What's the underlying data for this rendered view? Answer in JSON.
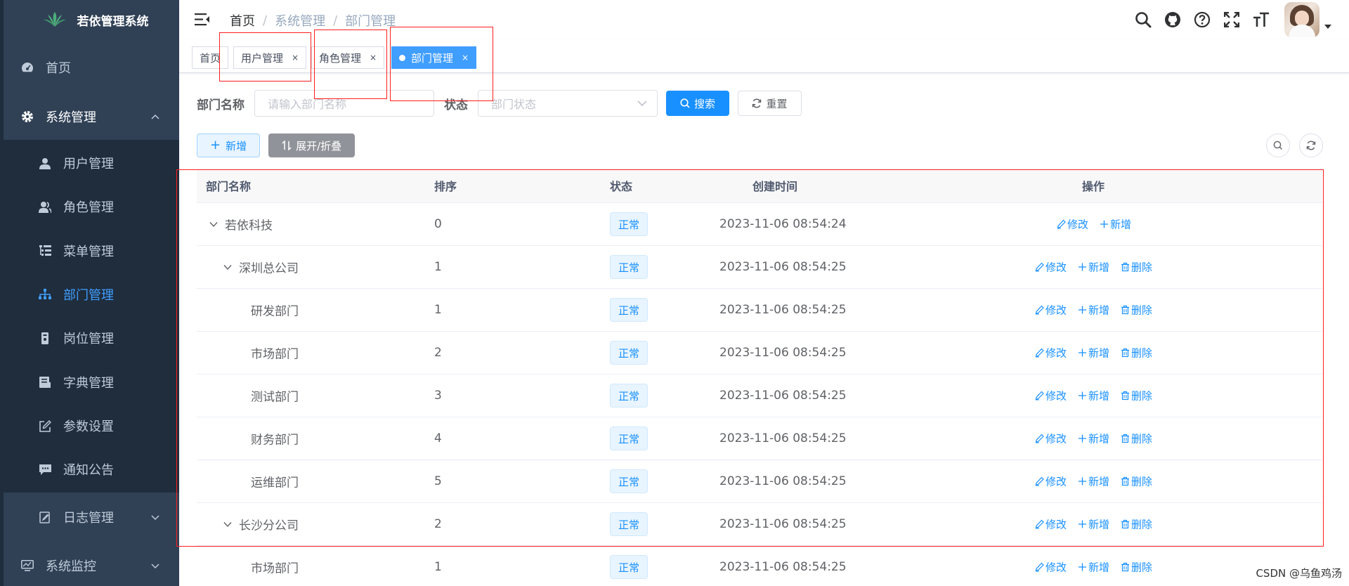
{
  "app": {
    "title": "若依管理系统"
  },
  "sidebar": {
    "items": [
      {
        "label": "首页",
        "icon": "dashboard-icon"
      },
      {
        "label": "系统管理",
        "icon": "gear-icon",
        "expanded": true,
        "children": [
          {
            "label": "用户管理",
            "icon": "user-icon"
          },
          {
            "label": "角色管理",
            "icon": "peoples-icon"
          },
          {
            "label": "菜单管理",
            "icon": "tree-table-icon"
          },
          {
            "label": "部门管理",
            "icon": "tree-icon",
            "active": true
          },
          {
            "label": "岗位管理",
            "icon": "post-icon"
          },
          {
            "label": "字典管理",
            "icon": "dict-icon"
          },
          {
            "label": "参数设置",
            "icon": "edit-icon"
          },
          {
            "label": "通知公告",
            "icon": "message-icon"
          },
          {
            "label": "日志管理",
            "icon": "log-icon"
          }
        ]
      },
      {
        "label": "系统监控",
        "icon": "monitor-icon"
      }
    ]
  },
  "breadcrumb": {
    "home": "首页",
    "section": "系统管理",
    "page": "部门管理"
  },
  "navbar": {
    "icons": [
      "search-icon",
      "github-icon",
      "question-icon",
      "fullscreen-icon",
      "font-size-icon"
    ]
  },
  "tags": [
    {
      "label": "首页",
      "closable": false
    },
    {
      "label": "用户管理",
      "closable": true
    },
    {
      "label": "角色管理",
      "closable": true
    },
    {
      "label": "部门管理",
      "closable": true,
      "active": true
    }
  ],
  "tag_close": "×",
  "search": {
    "dept_label": "部门名称",
    "dept_placeholder": "请输入部门名称",
    "status_label": "状态",
    "status_placeholder": "部门状态",
    "search_btn": "搜索",
    "reset_btn": "重置"
  },
  "toolbar": {
    "add_btn": "新增",
    "expand_btn": "展开/折叠"
  },
  "table": {
    "columns": [
      "部门名称",
      "排序",
      "状态",
      "创建时间",
      "操作"
    ],
    "rows": [
      {
        "name": "若依科技",
        "level": 0,
        "expandable": true,
        "order": "0",
        "status": "正常",
        "created": "2023-11-06 08:54:24",
        "ops": [
          "修改",
          "新增"
        ]
      },
      {
        "name": "深圳总公司",
        "level": 1,
        "expandable": true,
        "order": "1",
        "status": "正常",
        "created": "2023-11-06 08:54:25",
        "ops": [
          "修改",
          "新增",
          "删除"
        ]
      },
      {
        "name": "研发部门",
        "level": 2,
        "expandable": false,
        "order": "1",
        "status": "正常",
        "created": "2023-11-06 08:54:25",
        "ops": [
          "修改",
          "新增",
          "删除"
        ]
      },
      {
        "name": "市场部门",
        "level": 2,
        "expandable": false,
        "order": "2",
        "status": "正常",
        "created": "2023-11-06 08:54:25",
        "ops": [
          "修改",
          "新增",
          "删除"
        ]
      },
      {
        "name": "测试部门",
        "level": 2,
        "expandable": false,
        "order": "3",
        "status": "正常",
        "created": "2023-11-06 08:54:25",
        "ops": [
          "修改",
          "新增",
          "删除"
        ]
      },
      {
        "name": "财务部门",
        "level": 2,
        "expandable": false,
        "order": "4",
        "status": "正常",
        "created": "2023-11-06 08:54:25",
        "ops": [
          "修改",
          "新增",
          "删除"
        ]
      },
      {
        "name": "运维部门",
        "level": 2,
        "expandable": false,
        "order": "5",
        "status": "正常",
        "created": "2023-11-06 08:54:25",
        "ops": [
          "修改",
          "新增",
          "删除"
        ]
      },
      {
        "name": "长沙分公司",
        "level": 1,
        "expandable": true,
        "order": "2",
        "status": "正常",
        "created": "2023-11-06 08:54:25",
        "ops": [
          "修改",
          "新增",
          "删除"
        ]
      },
      {
        "name": "市场部门",
        "level": 2,
        "expandable": false,
        "order": "1",
        "status": "正常",
        "created": "2023-11-06 08:54:25",
        "ops": [
          "修改",
          "新增",
          "删除"
        ]
      }
    ]
  },
  "colors": {
    "sidebar_bg": "#304156",
    "primary": "#1890ff",
    "annotation": "#ff1e1e"
  },
  "watermark": "CSDN @乌鱼鸡汤"
}
